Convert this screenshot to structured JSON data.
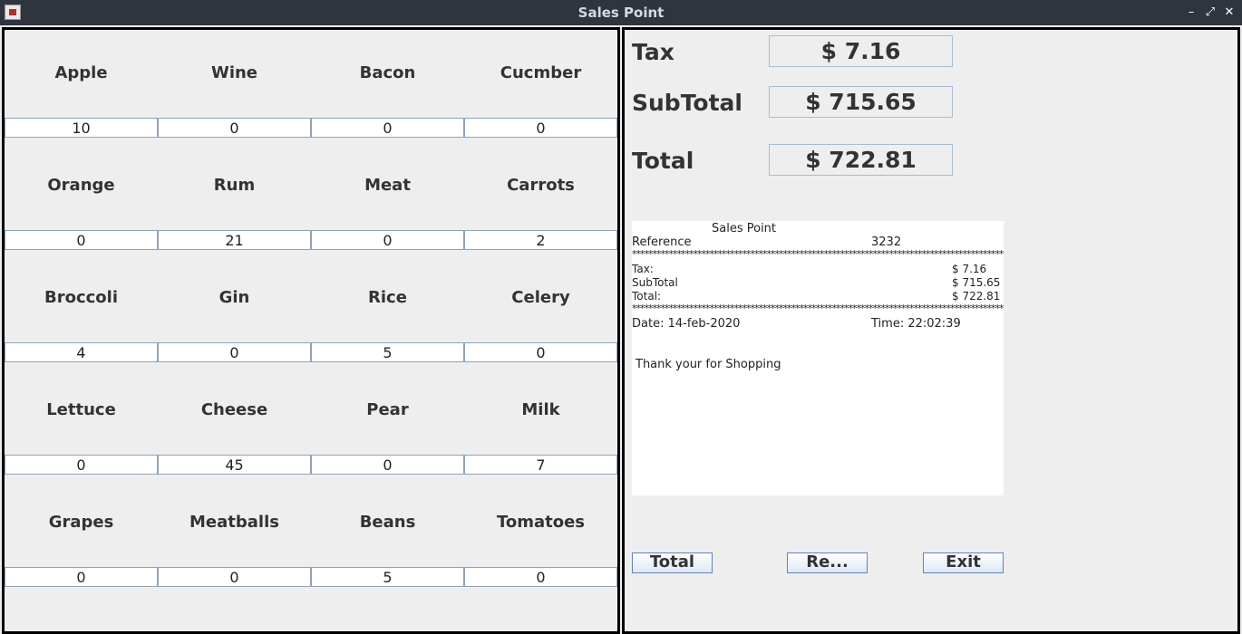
{
  "window": {
    "title": "Sales Point",
    "controls": [
      "–",
      "⤢",
      "✕"
    ]
  },
  "items": [
    {
      "name": "Apple",
      "qty": "10"
    },
    {
      "name": "Wine",
      "qty": "0"
    },
    {
      "name": "Bacon",
      "qty": "0"
    },
    {
      "name": "Cucmber",
      "qty": "0"
    },
    {
      "name": "Orange",
      "qty": "0"
    },
    {
      "name": "Rum",
      "qty": "21"
    },
    {
      "name": "Meat",
      "qty": "0"
    },
    {
      "name": "Carrots",
      "qty": "2"
    },
    {
      "name": "Broccoli",
      "qty": "4"
    },
    {
      "name": "Gin",
      "qty": "0"
    },
    {
      "name": "Rice",
      "qty": "5"
    },
    {
      "name": "Celery",
      "qty": "0"
    },
    {
      "name": "Lettuce",
      "qty": "0"
    },
    {
      "name": "Cheese",
      "qty": "45"
    },
    {
      "name": "Pear",
      "qty": "0"
    },
    {
      "name": "Milk",
      "qty": "7"
    },
    {
      "name": "Grapes",
      "qty": "0"
    },
    {
      "name": "Meatballs",
      "qty": "0"
    },
    {
      "name": "Beans",
      "qty": "5"
    },
    {
      "name": "Tomatoes",
      "qty": "0"
    }
  ],
  "totals": {
    "tax_label": "Tax",
    "tax_value": "$ 7.16",
    "subtotal_label": "SubTotal",
    "subtotal_value": "$ 715.65",
    "total_label": "Total",
    "total_value": "$ 722.81"
  },
  "receipt": {
    "header": "Sales Point",
    "reference_label": "Reference",
    "reference_value": "3232",
    "separator": "************************************************************************************************",
    "tax_label": "Tax:",
    "tax_value": "$ 7.16",
    "subtotal_label": "SubTotal",
    "subtotal_value": "$ 715.65",
    "total_label": "Total:",
    "total_value": "$ 722.81",
    "date": "Date: 14-feb-2020",
    "time": "Time: 22:02:39",
    "thanks": "Thank your for Shopping"
  },
  "buttons": {
    "total": "Total",
    "reset": "Re...",
    "exit": "Exit"
  }
}
